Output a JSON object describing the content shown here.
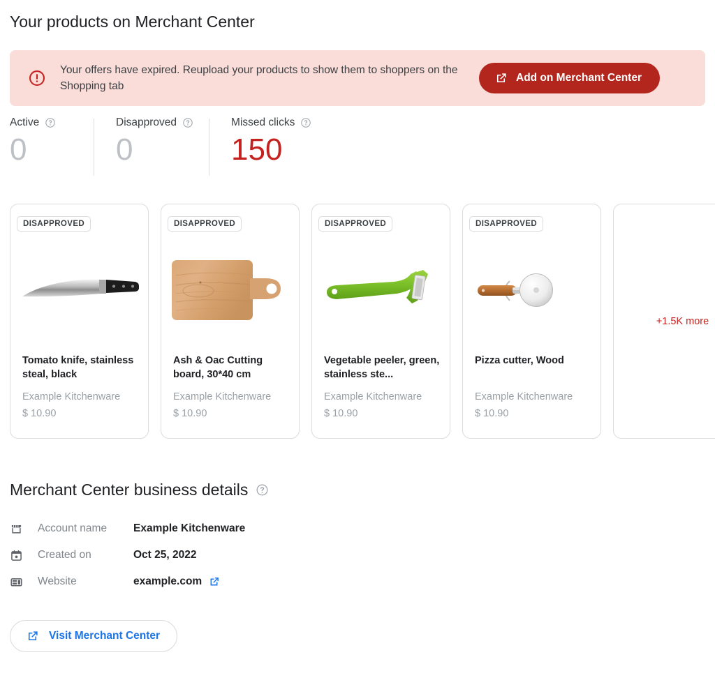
{
  "page_title": "Your products on Merchant Center",
  "alert": {
    "icon": "error-circle-icon",
    "message": "Your offers have expired. Reupload your products to show them to shoppers on the Shopping tab",
    "button_label": "Add on Merchant Center",
    "button_icon": "external-link-icon",
    "background_color": "#fadcd8",
    "button_color": "#b3261e"
  },
  "stats": [
    {
      "label": "Active",
      "value": "0",
      "help_icon": "help-circle-icon",
      "highlighted": false
    },
    {
      "label": "Disapproved",
      "value": "0",
      "help_icon": "help-circle-icon",
      "highlighted": false
    },
    {
      "label": "Missed clicks",
      "value": "150",
      "help_icon": "help-circle-icon",
      "highlighted": true
    }
  ],
  "stat_colors": {
    "muted": "#bdc1c6",
    "alert": "#c5221f"
  },
  "products": [
    {
      "badge": "DISAPPROVED",
      "title": "Tomato knife, stainless steal, black",
      "merchant": "Example Kitchenware",
      "price": "$ 10.90",
      "image": "chef-knife-image"
    },
    {
      "badge": "DISAPPROVED",
      "title": "Ash & Oac Cutting board, 30*40 cm",
      "merchant": "Example Kitchenware",
      "price": "$ 10.90",
      "image": "cutting-board-image"
    },
    {
      "badge": "DISAPPROVED",
      "title": "Vegetable peeler, green, stainless ste...",
      "merchant": "Example Kitchenware",
      "price": "$ 10.90",
      "image": "vegetable-peeler-image"
    },
    {
      "badge": "DISAPPROVED",
      "title": "Pizza cutter, Wood",
      "merchant": "Example Kitchenware",
      "price": "$ 10.90",
      "image": "pizza-cutter-image"
    }
  ],
  "more_card": {
    "label": "+1.5K more",
    "color": "#c5221f"
  },
  "business_details": {
    "section_title": "Merchant Center business details",
    "help_icon": "help-circle-icon",
    "rows": [
      {
        "icon": "storefront-icon",
        "label": "Account name",
        "value": "Example Kitchenware",
        "link": false
      },
      {
        "icon": "calendar-icon",
        "label": "Created on",
        "value": "Oct 25, 2022",
        "link": false
      },
      {
        "icon": "web-page-icon",
        "label": "Website",
        "value": "example.com",
        "link": true,
        "link_icon": "external-link-icon"
      }
    ]
  },
  "visit_button": {
    "label": "Visit Merchant Center",
    "icon": "external-link-icon",
    "color": "#1a73e8"
  }
}
